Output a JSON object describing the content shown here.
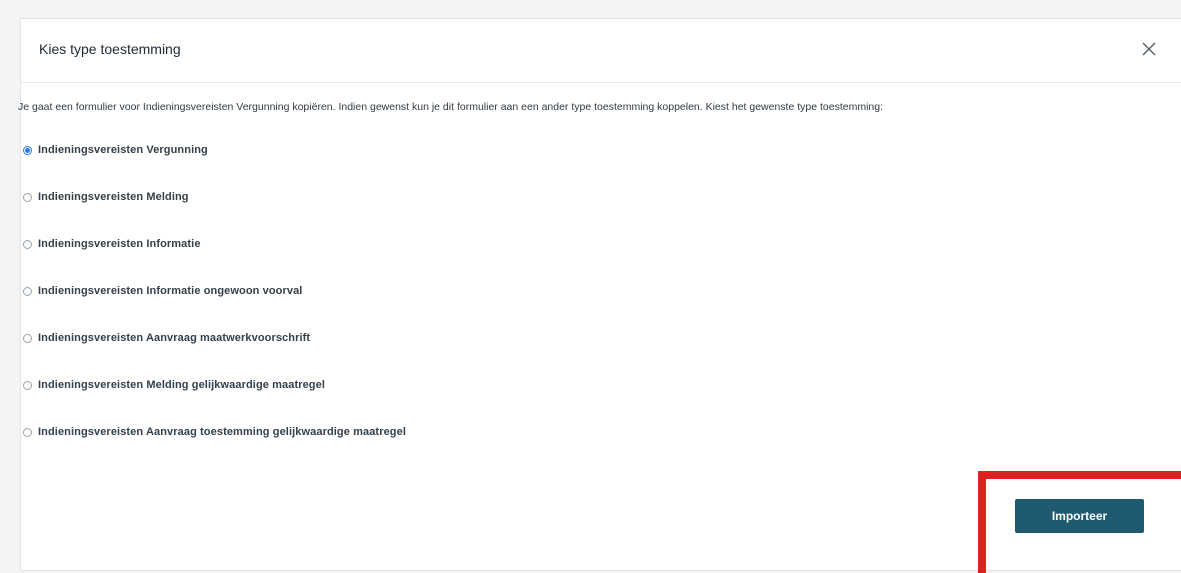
{
  "dialog": {
    "title": "Kies type toestemming",
    "close_icon": "close-icon",
    "intro_text": "Je gaat een formulier voor Indieningsvereisten Vergunning kopiëren. Indien gewenst kun je dit formulier aan een ander type toestemming koppelen. Kiest het gewenste type toestemming:",
    "options": [
      {
        "label": "Indieningsvereisten Vergunning",
        "selected": true
      },
      {
        "label": "Indieningsvereisten Melding",
        "selected": false
      },
      {
        "label": "Indieningsvereisten Informatie",
        "selected": false
      },
      {
        "label": "Indieningsvereisten Informatie ongewoon voorval",
        "selected": false
      },
      {
        "label": "Indieningsvereisten Aanvraag maatwerkvoorschrift",
        "selected": false
      },
      {
        "label": "Indieningsvereisten Melding gelijkwaardige maatregel",
        "selected": false
      },
      {
        "label": "Indieningsvereisten Aanvraag toestemming gelijkwaardige maatregel",
        "selected": false
      }
    ],
    "import_button_label": "Importeer"
  },
  "colors": {
    "primary_button": "#1f5a70",
    "radio_selected": "#2d7be6",
    "annotation_highlight": "#e02020"
  }
}
